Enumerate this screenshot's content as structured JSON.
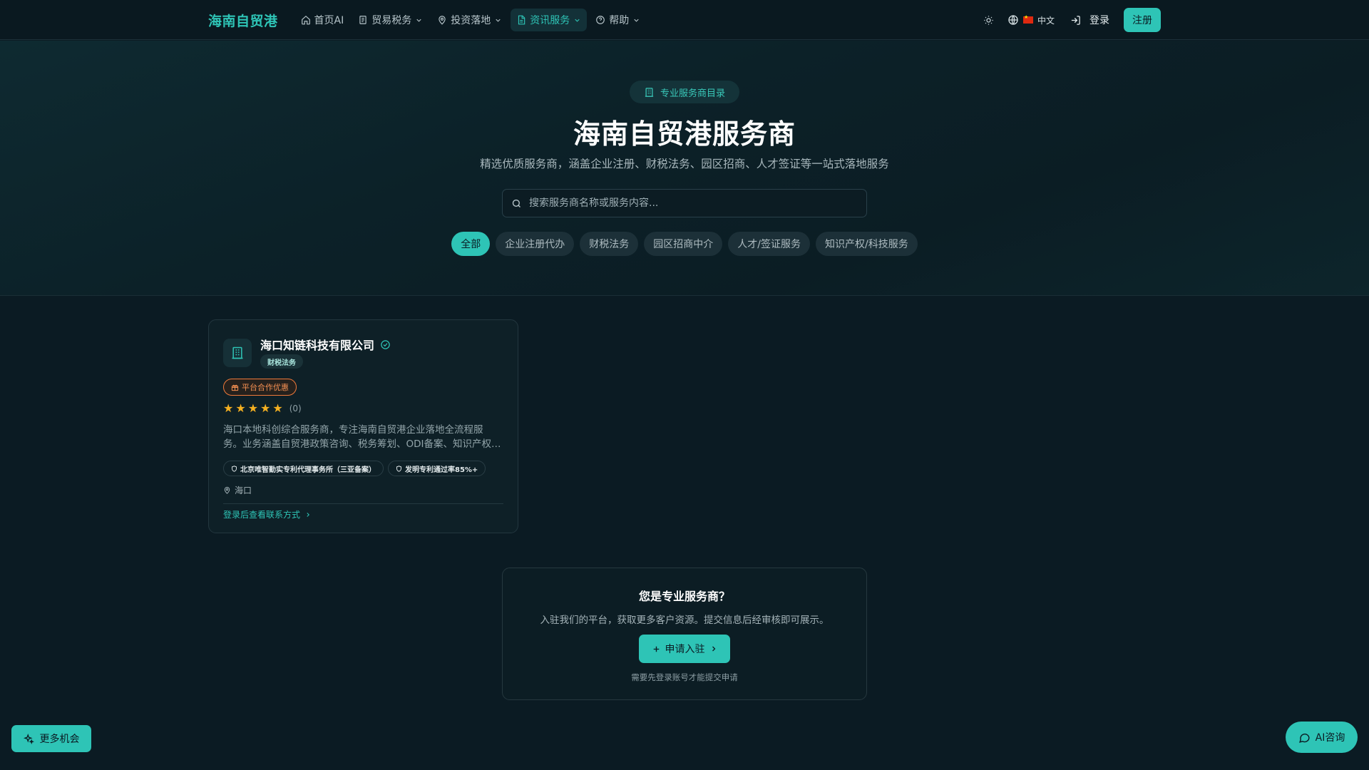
{
  "nav": {
    "brand": "海南自贸港",
    "items": [
      {
        "label": "首页AI",
        "icon": "home-icon"
      },
      {
        "label": "贸易税务",
        "icon": "receipt-icon"
      },
      {
        "label": "投资落地",
        "icon": "map-pin-icon"
      },
      {
        "label": "资讯服务",
        "icon": "document-icon",
        "active": true
      },
      {
        "label": "帮助",
        "icon": "help-circle-icon"
      }
    ],
    "language": "中文",
    "login": "登录",
    "register": "注册"
  },
  "hero": {
    "badge": "专业服务商目录",
    "title": "海南自贸港服务商",
    "subtitle": "精选优质服务商，涵盖企业注册、财税法务、园区招商、人才签证等一站式落地服务",
    "search_placeholder": "搜索服务商名称或服务内容...",
    "filters": [
      "全部",
      "企业注册代办",
      "财税法务",
      "园区招商中介",
      "人才/签证服务",
      "知识产权/科技服务"
    ],
    "active_filter": "全部"
  },
  "provider": {
    "name": "海口知链科技有限公司",
    "category": "财税法务",
    "promo": "平台合作优惠",
    "rating": 5,
    "review_count": "(0)",
    "description_lines": [
      "海口本地科创综合服务商，专注海南自贸港企业落地全流程服务。业务涵盖自贸港政策咨询、税务筹划、ODI备案、知识产权等一站式服务",
      "务。业务涵盖自贸港政策咨询、税务筹划、ODI备案、知识产权等一站式服务"
    ],
    "credentials": [
      "北京唯智勤实专利代理事务所（三亚备案）",
      "发明专利通过率85%+"
    ],
    "location": "海口",
    "contact_link": "登录后查看联系方式"
  },
  "cta": {
    "title": "您是专业服务商？",
    "description": "入驻我们的平台，获取更多客户资源。提交信息后经审核即可展示。",
    "button": "申请入驻",
    "note": "需要先登录账号才能提交申请"
  },
  "floating": {
    "left": "更多机会",
    "right": "AI咨询"
  },
  "colors": {
    "accent": "#2ec4b6",
    "background": "#0b1b23",
    "promo": "#f07a3a",
    "star": "#f5b021"
  }
}
